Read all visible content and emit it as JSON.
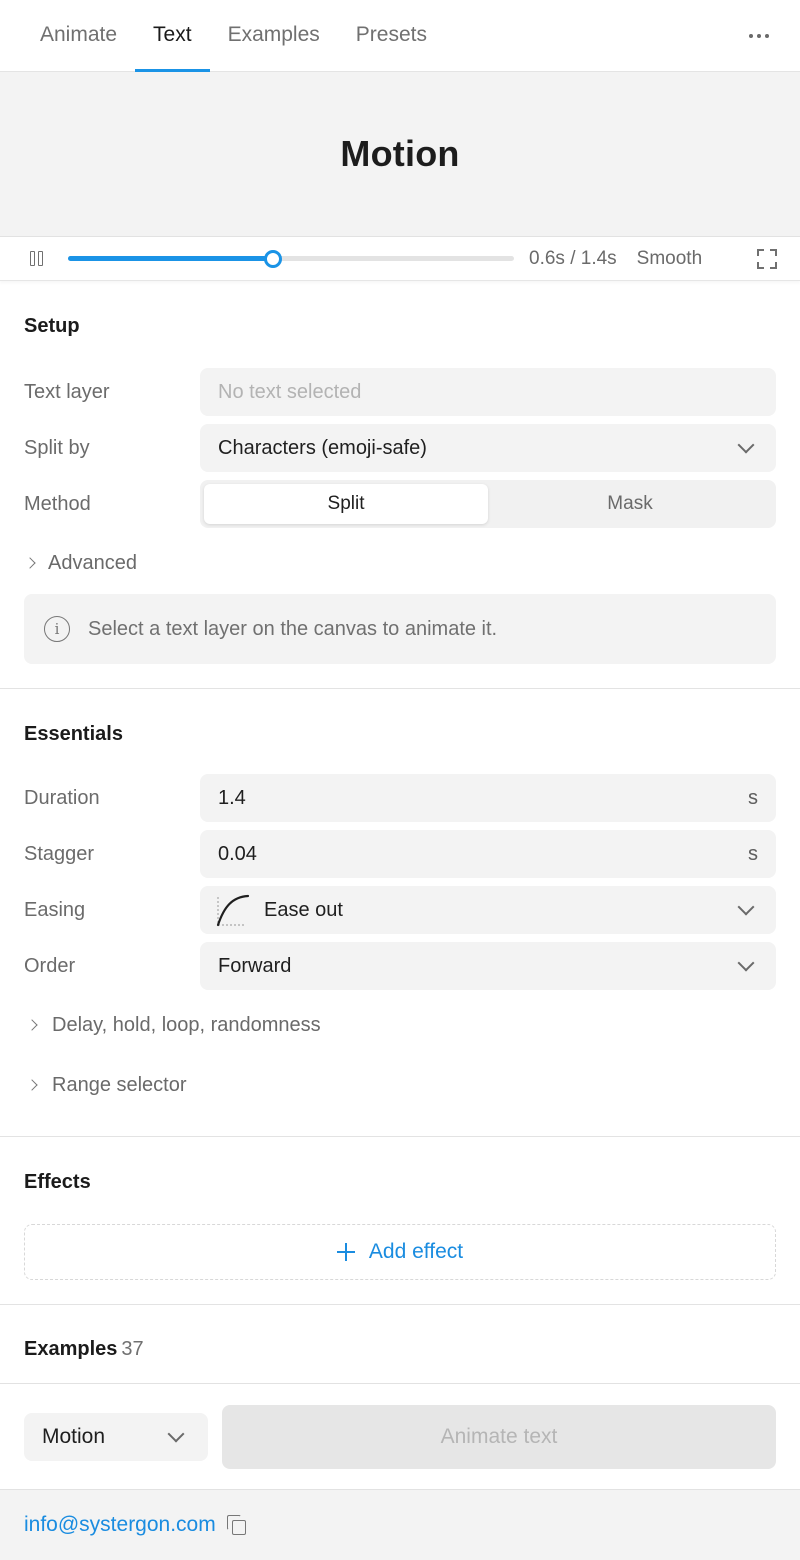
{
  "tabs": [
    {
      "label": "Animate",
      "active": false
    },
    {
      "label": "Text",
      "active": true
    },
    {
      "label": "Examples",
      "active": false
    },
    {
      "label": "Presets",
      "active": false
    }
  ],
  "preview": {
    "text": "Motion"
  },
  "playback": {
    "progress": 0.46,
    "time": "0.6s / 1.4s",
    "mode": "Smooth"
  },
  "setup": {
    "title": "Setup",
    "text_layer": {
      "label": "Text layer",
      "placeholder": "No text selected"
    },
    "split_by": {
      "label": "Split by",
      "value": "Characters (emoji-safe)"
    },
    "method": {
      "label": "Method",
      "options": [
        "Split",
        "Mask"
      ],
      "selected": "Split"
    },
    "advanced": "Advanced",
    "info": "Select a text layer on the canvas to animate it."
  },
  "essentials": {
    "title": "Essentials",
    "duration": {
      "label": "Duration",
      "value": "1.4",
      "unit": "s"
    },
    "stagger": {
      "label": "Stagger",
      "value": "0.04",
      "unit": "s"
    },
    "easing": {
      "label": "Easing",
      "value": "Ease out"
    },
    "order": {
      "label": "Order",
      "value": "Forward"
    },
    "delay": "Delay, hold, loop, randomness",
    "range": "Range selector"
  },
  "effects": {
    "title": "Effects",
    "add_label": "Add effect"
  },
  "examples": {
    "title": "Examples",
    "count": "37"
  },
  "bottom": {
    "preset": "Motion",
    "animate_label": "Animate text"
  },
  "footer": {
    "email": "info@systergon.com"
  },
  "colors": {
    "accent": "#1a93e6",
    "link": "#1a8ce0"
  }
}
